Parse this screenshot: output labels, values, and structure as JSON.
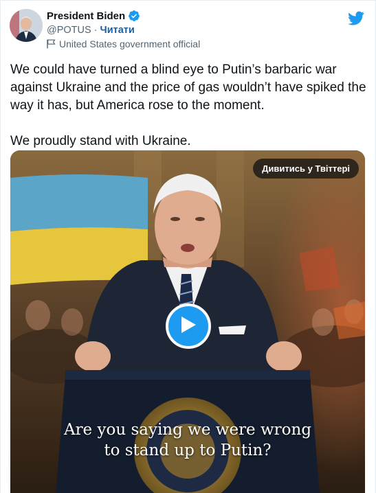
{
  "author": {
    "name": "President Biden",
    "handle": "@POTUS",
    "separator": "·",
    "follow_label": "Читати",
    "account_label": "United States government official"
  },
  "tweet": {
    "paragraphs": [
      "We could have turned a blind eye to Putin’s barbaric war against Ukraine and the price of gas wouldn’t have spiked the way it has, but America rose to the moment.",
      "We proudly stand with Ukraine."
    ]
  },
  "media": {
    "watch_label": "Дивитись у Твіттері",
    "caption_lines": [
      "Are you saying we were wrong",
      "to stand up to Putin?"
    ]
  },
  "colors": {
    "twitter_blue": "#1d9bf0",
    "link_blue": "#1b5f9e",
    "muted_text": "#536471"
  },
  "icons": [
    "verified-badge-icon",
    "government-flag-icon",
    "twitter-bird-icon",
    "play-icon"
  ]
}
